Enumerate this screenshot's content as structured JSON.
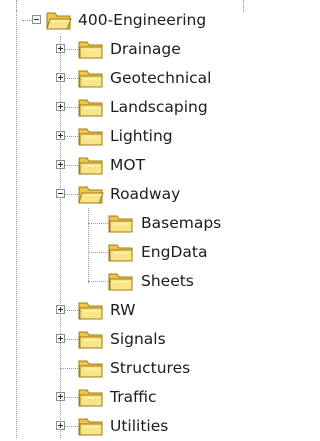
{
  "tree": {
    "root": {
      "label": "400-Engineering",
      "expanded": true,
      "icon": "folder-open-icon"
    },
    "children": [
      {
        "label": "Drainage",
        "expanded": false,
        "has_children": true
      },
      {
        "label": "Geotechnical",
        "expanded": false,
        "has_children": true
      },
      {
        "label": "Landscaping",
        "expanded": false,
        "has_children": true
      },
      {
        "label": "Lighting",
        "expanded": false,
        "has_children": true
      },
      {
        "label": "MOT",
        "expanded": false,
        "has_children": true
      },
      {
        "label": "Roadway",
        "expanded": true,
        "has_children": true,
        "children": [
          {
            "label": "Basemaps"
          },
          {
            "label": "EngData"
          },
          {
            "label": "Sheets"
          }
        ]
      },
      {
        "label": "RW",
        "expanded": false,
        "has_children": true
      },
      {
        "label": "Signals",
        "expanded": false,
        "has_children": true
      },
      {
        "label": "Structures",
        "expanded": false,
        "has_children": false
      },
      {
        "label": "Traffic",
        "expanded": false,
        "has_children": true
      },
      {
        "label": "Utilities",
        "expanded": false,
        "has_children": true
      }
    ]
  },
  "colors": {
    "folder_back": "#ecc64a",
    "folder_front": "#f8e58a",
    "folder_outline": "#a07c12",
    "tree_line": "#9a9a9a"
  }
}
